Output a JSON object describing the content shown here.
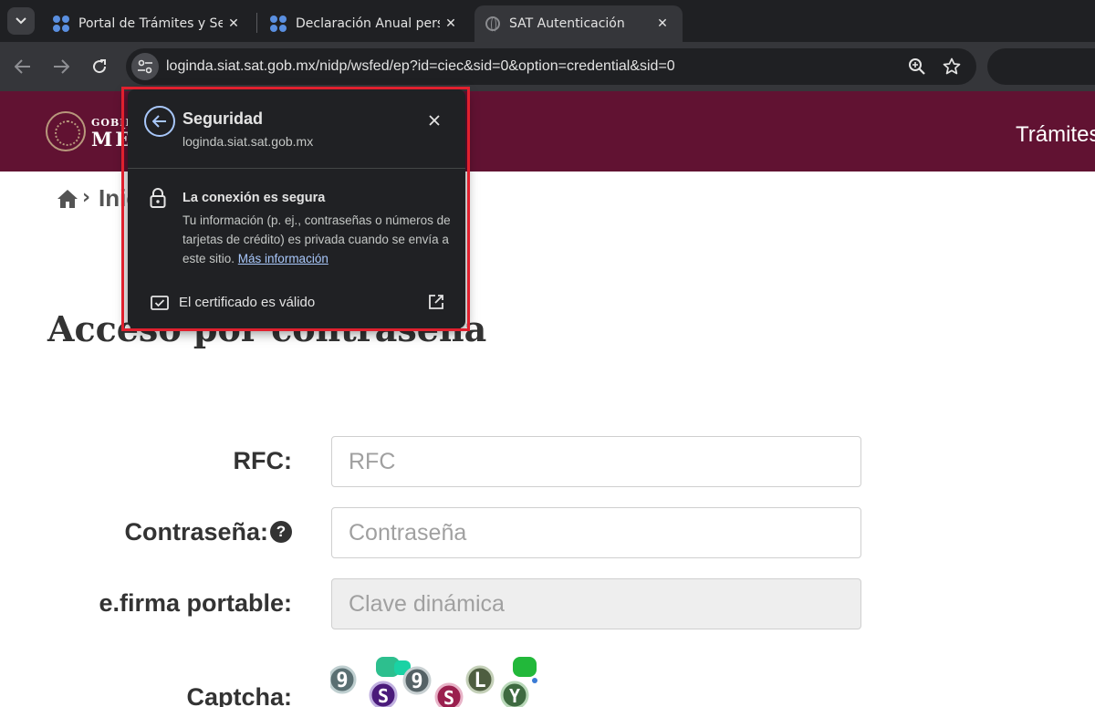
{
  "browser": {
    "tabs": [
      {
        "title": "Portal de Trámites y Servicios",
        "favicon": "sat-dots-icon",
        "active": false
      },
      {
        "title": "Declaración Anual personas",
        "favicon": "sat-dots-icon",
        "active": false
      },
      {
        "title": "SAT Autenticación",
        "favicon": "globe-icon",
        "active": true
      }
    ],
    "url": "loginda.siat.sat.gob.mx/nidp/wsfed/ep?id=ciec&sid=0&option=credential&sid=0"
  },
  "site_header": {
    "gob_label": "GOBIERNO DE",
    "mex_label": "MÉXICO",
    "nav_item": "Trámites"
  },
  "breadcrumb": {
    "text": "Inicio"
  },
  "page": {
    "title": "Acceso por contraseña"
  },
  "form": {
    "rfc_label": "RFC:",
    "rfc_placeholder": "RFC",
    "password_label": "Contraseña:",
    "password_placeholder": "Contraseña",
    "efirma_label": "e.firma portable:",
    "efirma_placeholder": "Clave dinámica",
    "captcha_label": "Captcha:",
    "captcha_chars": [
      "9",
      "S",
      "9",
      "S",
      "L",
      "Y"
    ]
  },
  "security_popup": {
    "title": "Seguridad",
    "host": "loginda.siat.sat.gob.mx",
    "connection_title": "La conexión es segura",
    "connection_desc": "Tu información (p. ej., contraseñas o números de tarjetas de crédito) es privada cuando se envía a este sitio.",
    "more_info_link": "Más información",
    "certificate_label": "El certificado es válido"
  },
  "colors": {
    "brand": "#611232",
    "highlight": "#e0202e",
    "link": "#a8c7fa"
  }
}
